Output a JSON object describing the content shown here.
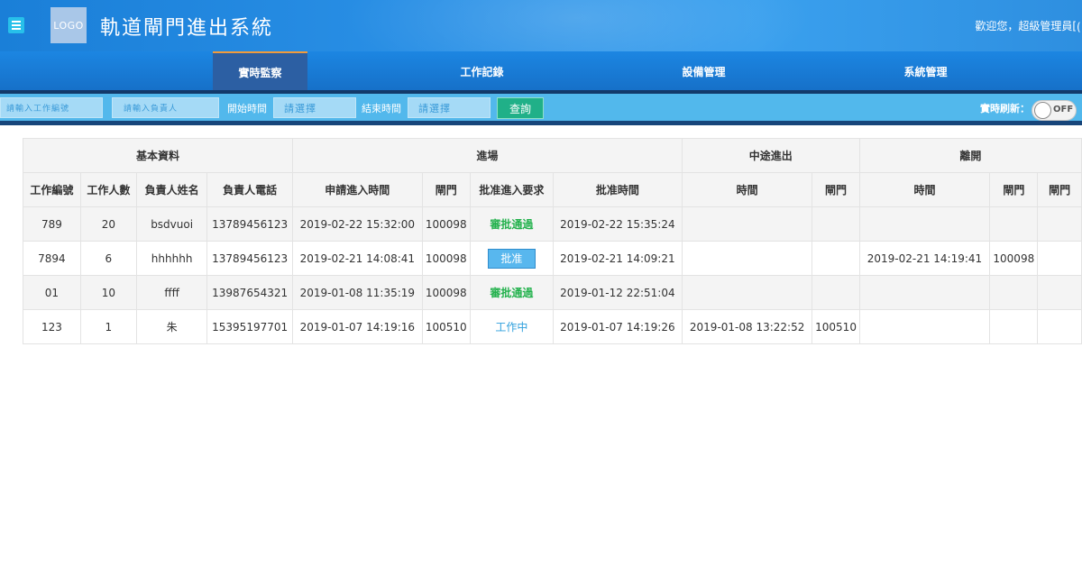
{
  "header": {
    "logo": "LOGO",
    "title": "軌道閘門進出系統",
    "welcome": "歡迎您，超級管理員[",
    "welcome_partial": "("
  },
  "nav": {
    "items": [
      {
        "label": "實時監察",
        "active": true
      },
      {
        "label": "工作記錄",
        "active": false
      },
      {
        "label": "設備管理",
        "active": false
      },
      {
        "label": "系統管理",
        "active": false
      }
    ]
  },
  "filter": {
    "work_no_placeholder": "請輸入工作編號",
    "owner_placeholder": "請輸入負責人",
    "start_label": "開始時間",
    "start_placeholder": "請選擇",
    "end_label": "結束時間",
    "end_placeholder": "請選擇",
    "search_label": "查詢",
    "refresh_label": "實時刷新：",
    "refresh_state": "OFF"
  },
  "table": {
    "groups": [
      {
        "label": "基本資料"
      },
      {
        "label": "進場"
      },
      {
        "label": "中途進出"
      },
      {
        "label": "離開"
      }
    ],
    "columns": [
      "工作編號",
      "工作人數",
      "負責人姓名",
      "負責人電話",
      "申請進入時間",
      "閘門",
      "批准進入要求",
      "批准時間",
      "時間",
      "閘門",
      "時間",
      "閘門",
      "閘門"
    ],
    "rows": [
      {
        "id": "789",
        "count": "20",
        "name": "bsdvuoi",
        "phone": "13789456123",
        "apply_time": "2019-02-22 15:32:00",
        "gate": "100098",
        "status": "審批通過",
        "status_type": "approved",
        "approve_time": "2019-02-22 15:35:24",
        "mid_time": "",
        "mid_gate": "",
        "leave_time": "",
        "leave_gate": "",
        "extra": ""
      },
      {
        "id": "7894",
        "count": "6",
        "name": "hhhhhh",
        "phone": "13789456123",
        "apply_time": "2019-02-21 14:08:41",
        "gate": "100098",
        "status": "批准",
        "status_type": "button",
        "approve_time": "2019-02-21 14:09:21",
        "mid_time": "",
        "mid_gate": "",
        "leave_time": "2019-02-21 14:19:41",
        "leave_gate": "100098",
        "extra": ""
      },
      {
        "id": "01",
        "count": "10",
        "name": "ffff",
        "phone": "13987654321",
        "apply_time": "2019-01-08 11:35:19",
        "gate": "100098",
        "status": "審批通過",
        "status_type": "approved",
        "approve_time": "2019-01-12 22:51:04",
        "mid_time": "",
        "mid_gate": "",
        "leave_time": "",
        "leave_gate": "",
        "extra": ""
      },
      {
        "id": "123",
        "count": "1",
        "name": "朱",
        "phone": "15395197701",
        "apply_time": "2019-01-07 14:19:16",
        "gate": "100510",
        "status": "工作中",
        "status_type": "working",
        "approve_time": "2019-01-07 14:19:26",
        "mid_time": "2019-01-08 13:22:52",
        "mid_gate": "100510",
        "leave_time": "",
        "leave_gate": "",
        "extra": ""
      }
    ]
  },
  "colors": {
    "header_blue": "#1a7fd8",
    "nav_active": "#2c5fa3",
    "filter_bar": "#52b8ec",
    "search_button": "#20b088",
    "approved_text": "#22b14c",
    "working_text": "#2fa0dd",
    "approve_button": "#58b7ee"
  },
  "icons": {
    "menu": "hamburger-menu-icon"
  }
}
